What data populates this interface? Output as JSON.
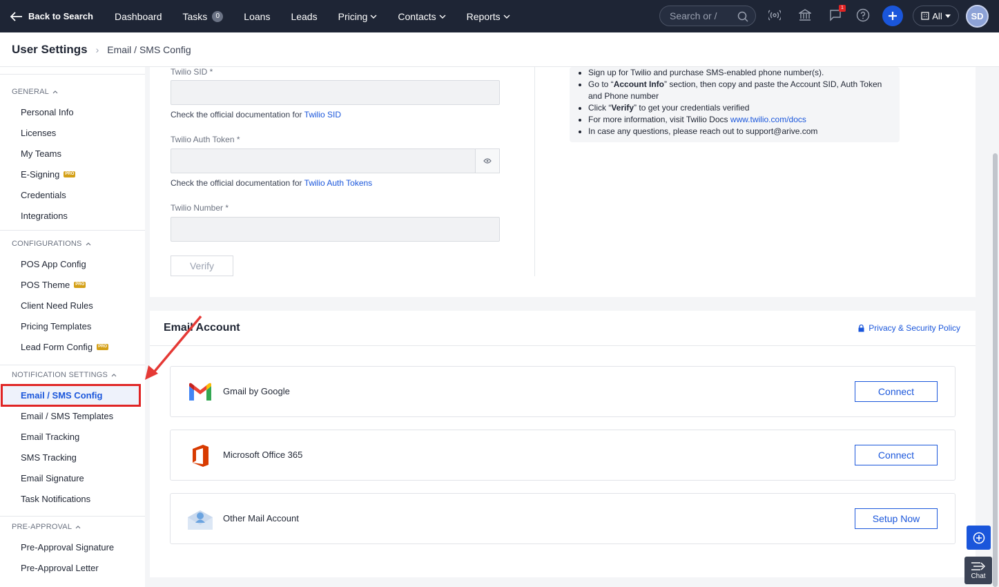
{
  "topnav": {
    "back_label": "Back to Search",
    "items": [
      {
        "label": "Dashboard"
      },
      {
        "label": "Tasks",
        "count": "0"
      },
      {
        "label": "Loans"
      },
      {
        "label": "Leads"
      },
      {
        "label": "Pricing"
      },
      {
        "label": "Contacts"
      },
      {
        "label": "Reports"
      }
    ],
    "search_placeholder": "Search or /",
    "notification_count": "1",
    "all_label": "All",
    "avatar_initials": "SD"
  },
  "header": {
    "title": "User Settings",
    "breadcrumb": "Email / SMS Config"
  },
  "sidebar": {
    "sections": [
      {
        "title": "GENERAL",
        "items": [
          "Personal Info",
          "Licenses",
          "My Teams",
          "E-Signing",
          "Credentials",
          "Integrations"
        ]
      },
      {
        "title": "CONFIGURATIONS",
        "items": [
          "POS App Config",
          "POS Theme",
          "Client Need Rules",
          "Pricing Templates",
          "Lead Form Config"
        ]
      },
      {
        "title": "NOTIFICATION SETTINGS",
        "items": [
          "Email / SMS Config",
          "Email / SMS Templates",
          "Email Tracking",
          "SMS Tracking",
          "Email Signature",
          "Task Notifications"
        ]
      },
      {
        "title": "PRE-APPROVAL",
        "items": [
          "Pre-Approval Signature",
          "Pre-Approval Letter"
        ]
      }
    ],
    "pro_badge": "PRO",
    "active_item": "Email / SMS Config"
  },
  "twilio": {
    "sid_label": "Twilio SID *",
    "sid_help_prefix": "Check the official documentation for ",
    "sid_help_link": "Twilio SID",
    "token_label": "Twilio Auth Token *",
    "token_help_prefix": "Check the official documentation for ",
    "token_help_link": "Twilio Auth Tokens",
    "number_label": "Twilio Number *",
    "verify_label": "Verify",
    "instructions": {
      "line1": "Sign up for Twilio and purchase SMS-enabled phone number(s).",
      "line2_a": "Go to “",
      "line2_b": "Account Info",
      "line2_c": "” section, then copy and paste the Account SID, Auth Token and Phone number",
      "line3_a": "Click “",
      "line3_b": "Verify",
      "line3_c": "” to get your credentials verified",
      "line4_a": "For more information, visit Twilio Docs ",
      "line4_link": "www.twilio.com/docs",
      "line5_a": "In case any questions, please reach out to ",
      "line5_email": "support@arive.com"
    }
  },
  "email_account": {
    "title": "Email Account",
    "privacy_label": "Privacy & Security Policy",
    "providers": [
      {
        "name": "Gmail by Google",
        "button": "Connect"
      },
      {
        "name": "Microsoft Office 365",
        "button": "Connect"
      },
      {
        "name": "Other Mail Account",
        "button": "Setup Now"
      }
    ]
  },
  "widgets": {
    "chat_label": "Chat"
  },
  "colors": {
    "nav_bg": "#1e2535",
    "accent": "#1a56db",
    "highlight": "#e02424",
    "pro_badge": "#d4a017"
  }
}
